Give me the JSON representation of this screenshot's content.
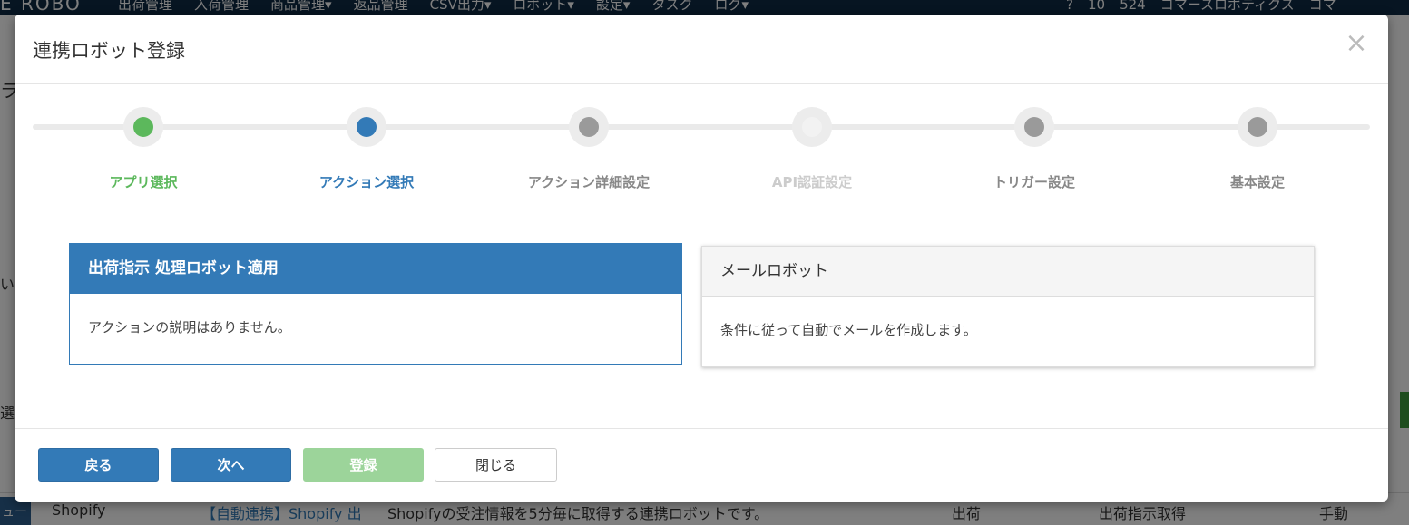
{
  "background": {
    "brand": "E ROBO",
    "nav": [
      "出荷管理",
      "入荷管理",
      "商品管理▾",
      "返品管理",
      "CSV出力▾",
      "ロボット▾",
      "設定▾",
      "タスク",
      "ログ▾"
    ],
    "right": [
      "?",
      "10",
      "524",
      "コマースロボティクス",
      "コマ"
    ],
    "left_fragments": [
      "ラ",
      "い",
      "選択",
      "ュー"
    ],
    "row": {
      "app": "Shopify",
      "robot_name": "【自動連携】Shopify 出",
      "description": "Shopifyの受注情報を5分毎に取得する連携ロボットです。",
      "type": "出荷",
      "action": "出荷指示取得",
      "mode": "手動"
    }
  },
  "modal": {
    "title": "連携ロボット登録",
    "close_glyph": "×"
  },
  "stepper": {
    "steps": [
      {
        "label": "アプリ選択",
        "state": "done",
        "dot_color": "#5cb85c",
        "label_color": "#5cb85c"
      },
      {
        "label": "アクション選択",
        "state": "current",
        "dot_color": "#337ab7",
        "label_color": "#337ab7"
      },
      {
        "label": "アクション詳細設定",
        "state": "pending",
        "dot_color": "#9a9a9a",
        "label_color": "#888888"
      },
      {
        "label": "API認証設定",
        "state": "disabled",
        "dot_color": "#f2f2f2",
        "label_color": "#cccccc"
      },
      {
        "label": "トリガー設定",
        "state": "pending",
        "dot_color": "#9a9a9a",
        "label_color": "#888888"
      },
      {
        "label": "基本設定",
        "state": "pending",
        "dot_color": "#9a9a9a",
        "label_color": "#888888"
      }
    ]
  },
  "actions": [
    {
      "title": "出荷指示 処理ロボット適用",
      "description": "アクションの説明はありません。",
      "selected": true
    },
    {
      "title": "メールロボット",
      "description": "条件に従って自動でメールを作成します。",
      "selected": false
    }
  ],
  "footer": {
    "back_label": "戻る",
    "next_label": "次へ",
    "register_label": "登録",
    "close_label": "閉じる"
  }
}
